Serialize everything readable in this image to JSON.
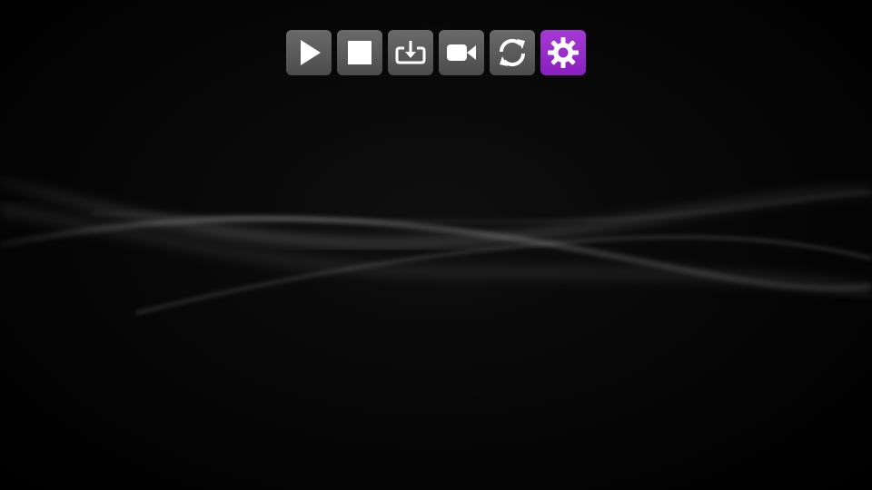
{
  "toolbar": {
    "buttons": [
      {
        "id": "play",
        "icon": "play-icon",
        "active": false
      },
      {
        "id": "stop",
        "icon": "stop-icon",
        "active": false
      },
      {
        "id": "download",
        "icon": "download-icon",
        "active": false
      },
      {
        "id": "record",
        "icon": "video-camera-icon",
        "active": false
      },
      {
        "id": "refresh",
        "icon": "refresh-icon",
        "active": false
      },
      {
        "id": "settings",
        "icon": "gear-icon",
        "active": true
      }
    ]
  },
  "colors": {
    "background": "#000000",
    "button_bg": "#5a5a5a",
    "button_active_bg": "#9b2fd0",
    "icon_fg": "#ffffff"
  }
}
